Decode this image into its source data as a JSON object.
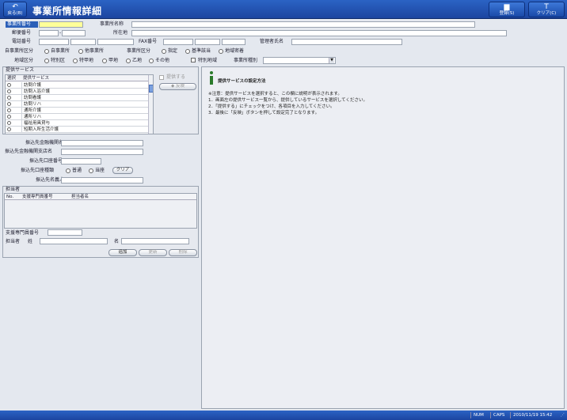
{
  "window": {
    "title": "事業所情報詳細",
    "back_label": "戻る(B)",
    "save_label": "登録(S)",
    "clear_label": "クリア(C)"
  },
  "form": {
    "office_number_label": "事業所番号",
    "office_name_label": "事業所名称",
    "postal_label": "郵便番号",
    "address_label": "所在地",
    "phone_label": "電話番号",
    "fax_label": "FAX番号",
    "manager_label": "管理者氏名",
    "self_class_label": "自事業所区分",
    "self_class_options": [
      "自事業所",
      "他事業所"
    ],
    "designation_label": "事業所区分",
    "designation_options": [
      "指定",
      "基準該当",
      "地域密着"
    ],
    "region_label": "地域区分",
    "region_options": [
      "特別区",
      "特甲地",
      "甲地",
      "乙地",
      "その他"
    ],
    "special_region_label": "特別地域",
    "office_type_label": "事業所種別"
  },
  "services": {
    "section_label": "提供サービス",
    "provide_label": "提供する",
    "reflect_label": "◆ 反映",
    "columns": [
      "選択",
      "提供サービス"
    ],
    "items": [
      "訪問介護",
      "訪問入浴介護",
      "訪問看護",
      "訪問リハ",
      "通所介護",
      "通所リハ",
      "福祉用具貸与",
      "短期入所生活介護"
    ]
  },
  "bank": {
    "bank_name_label": "振込先金融機関名",
    "branch_label": "振込先金融機関支店名",
    "account_no_label": "振込先口座番号",
    "account_type_label": "振込先口座種類",
    "account_types": [
      "普通",
      "当座"
    ],
    "clear_label": "クリア",
    "holder_label": "振込先名義人"
  },
  "staff": {
    "section_label": "担当者",
    "columns": [
      "No.",
      "支援専門員番号",
      "担当者名"
    ],
    "support_no_label": "支援専門員番号",
    "person_label": "担当者",
    "surname_label": "姓",
    "given_label": "名",
    "add_label": "追加",
    "update_label": "更新",
    "delete_label": "削除"
  },
  "info": {
    "title": "提供サービスの設定方法",
    "lines": [
      "※注意：提供サービスを選択すると、この欄に説明が表示されます。",
      "1．画面左の提供サービス一覧から、提供しているサービスを選択してください。",
      "2．「提供する」にチェックをつけ、各項目を入力してください。",
      "3．最後に「反映」ボタンを押して設定完了となります。"
    ]
  },
  "status": {
    "num": "NUM",
    "caps": "CAPS",
    "datetime": "2010/11/19 15:42"
  }
}
